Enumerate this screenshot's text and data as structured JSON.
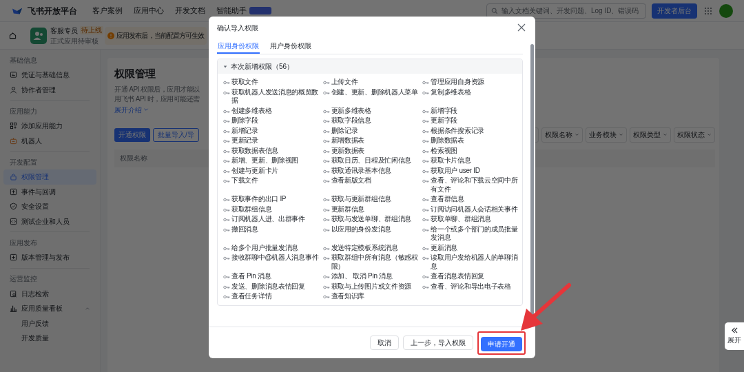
{
  "top_nav": {
    "logo": "飞书开放平台",
    "links": [
      "客户案例",
      "应用中心",
      "开发文档",
      "智能助手"
    ],
    "search": {
      "placeholder": "输入文档关键词、开发问题、Log ID、错误码"
    },
    "console_button": "开发者后台"
  },
  "app_bar": {
    "app_name": "客服专员",
    "status_badge": "待上线",
    "subtitle": "正式应用待审核",
    "notice": "应用发布后，当前配置方可生效"
  },
  "sidebar": {
    "sections": [
      {
        "heading": "基础信息",
        "items": [
          {
            "label": "凭证与基础信息",
            "selected": false
          },
          {
            "label": "协作者管理",
            "selected": false
          }
        ]
      },
      {
        "heading": "应用能力",
        "items": [
          {
            "label": "添加应用能力",
            "selected": false
          },
          {
            "label": "机器人",
            "selected": false
          }
        ]
      },
      {
        "heading": "开发配置",
        "items": [
          {
            "label": "权限管理",
            "selected": true
          },
          {
            "label": "事件与回调",
            "selected": false
          },
          {
            "label": "安全设置",
            "selected": false
          },
          {
            "label": "测试企业和人员",
            "selected": false
          }
        ]
      },
      {
        "heading": "应用发布",
        "items": [
          {
            "label": "版本管理与发布",
            "selected": false
          }
        ]
      },
      {
        "heading": "运营监控",
        "items": [
          {
            "label": "日志检索",
            "selected": false
          },
          {
            "label": "应用质量看板",
            "selected": false,
            "expanded": true,
            "children": [
              {
                "label": "用户反馈",
                "selected": false
              },
              {
                "label": "开发质量",
                "selected": false
              }
            ]
          }
        ]
      }
    ]
  },
  "main": {
    "title": "权限管理",
    "description_lines": [
      "开通 API 权限后，应用才能以",
      "用飞书 API 时，应用可能还需"
    ],
    "expand_link": "展开介绍",
    "buttons": [
      {
        "label": "开通权限",
        "kind": "primary"
      },
      {
        "label": "批量导入/导",
        "kind": "outline"
      }
    ],
    "filters": [
      "权限名称",
      "业务模块",
      "权限类型",
      "权限状态"
    ],
    "table": {
      "columns": [
        "权限名称"
      ]
    }
  },
  "side_toggle": {
    "label": "展开"
  },
  "modal": {
    "title": "确认导入权限",
    "tabs": [
      {
        "label": "应用身份权限",
        "selected": true
      },
      {
        "label": "用户身份权限",
        "selected": false
      }
    ],
    "section": {
      "title": "本次新增权限（56）",
      "expanded": true,
      "permissions": [
        "获取文件",
        "上传文件",
        "管理应用自身资源",
        "获取机器人发送消息的概览数据",
        "创建、更新、删除机器人菜单",
        "复制多维表格",
        "创建多维表格",
        "更新多维表格",
        "新增字段",
        "删除字段",
        "获取字段信息",
        "更新字段",
        "新增记录",
        "删除记录",
        "根据条件搜索记录",
        "更新记录",
        "新增数据表",
        "删除数据表",
        "获取数据表信息",
        "更新数据表",
        "检索视图",
        "新增、更新、删除视图",
        "获取日历、日程及忙闲信息",
        "获取卡片信息",
        "创建与更新卡片",
        "获取通讯录基本信息",
        "获取用户 user ID",
        "下载文件",
        "查看新版文档",
        "查看、评论和下载云空间中所有文件",
        "获取事件的出口 IP",
        "获取与更新群组信息",
        "查看群信息",
        "获取群组信息",
        "更新群信息",
        "订阅访问机器人会话相关事件",
        "订阅机器人进、出群事件",
        "获取与发送单聊、群组消息",
        "获取单聊、群组消息",
        "撤回消息",
        "以应用的身份发消息",
        "给一个或多个部门的成员批量发消息",
        "给多个用户批量发消息",
        "发送特定模板系统消息",
        "更新消息",
        "接收群聊中@机器人消息事件",
        "获取群组中所有消息（敏感权限）",
        "读取用户发给机器人的单聊消息",
        "查看 Pin 消息",
        "添加、 取消 Pin 消息",
        "查看消息表情回复",
        "发送、删除消息表情回复",
        "获取与上传图片或文件资源",
        "查看、评论和导出电子表格",
        "查看任务详情",
        "查看知识库"
      ]
    },
    "buttons": [
      {
        "label": "取消",
        "kind": "default",
        "highlighted": false
      },
      {
        "label": "上一步，导入权限",
        "kind": "default",
        "highlighted": false
      },
      {
        "label": "申请开通",
        "kind": "primary",
        "highlighted": true
      }
    ]
  }
}
